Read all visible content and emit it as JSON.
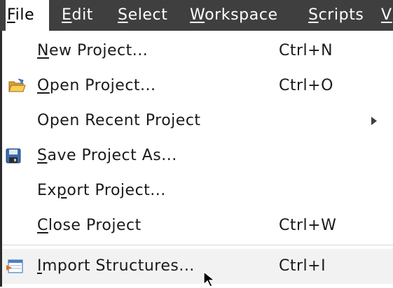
{
  "menubar": {
    "file": "File",
    "edit": "Edit",
    "select": "Select",
    "workspace": "Workspace",
    "scripts": "Scripts",
    "cut_off": "V"
  },
  "menu": {
    "items": [
      {
        "pre": "",
        "mnemonic": "N",
        "rest": "ew Project...",
        "shortcut": "Ctrl+N",
        "icon": ""
      },
      {
        "pre": "",
        "mnemonic": "O",
        "rest": "pen Project...",
        "shortcut": "Ctrl+O",
        "icon": "open-folder-icon"
      },
      {
        "pre": "Open Recent Project",
        "mnemonic": "",
        "rest": "",
        "shortcut": "",
        "icon": "",
        "submenu": true
      },
      {
        "pre": "",
        "mnemonic": "S",
        "rest": "ave Project As...",
        "shortcut": "",
        "icon": "save-icon"
      },
      {
        "pre": "Ex",
        "mnemonic": "p",
        "rest": "ort Project...",
        "shortcut": "",
        "icon": ""
      },
      {
        "pre": "",
        "mnemonic": "C",
        "rest": "lose Project",
        "shortcut": "Ctrl+W",
        "icon": ""
      },
      {
        "pre": "",
        "mnemonic": "I",
        "rest": "mport Structures...",
        "shortcut": "Ctrl+I",
        "icon": "import-structures-icon",
        "hovered": true
      }
    ]
  },
  "colors": {
    "menubar_bg": "#3f3f3f",
    "menu_bg": "#ffffff",
    "hover_bg": "#f2f2f2",
    "text": "#1a1a1a"
  }
}
